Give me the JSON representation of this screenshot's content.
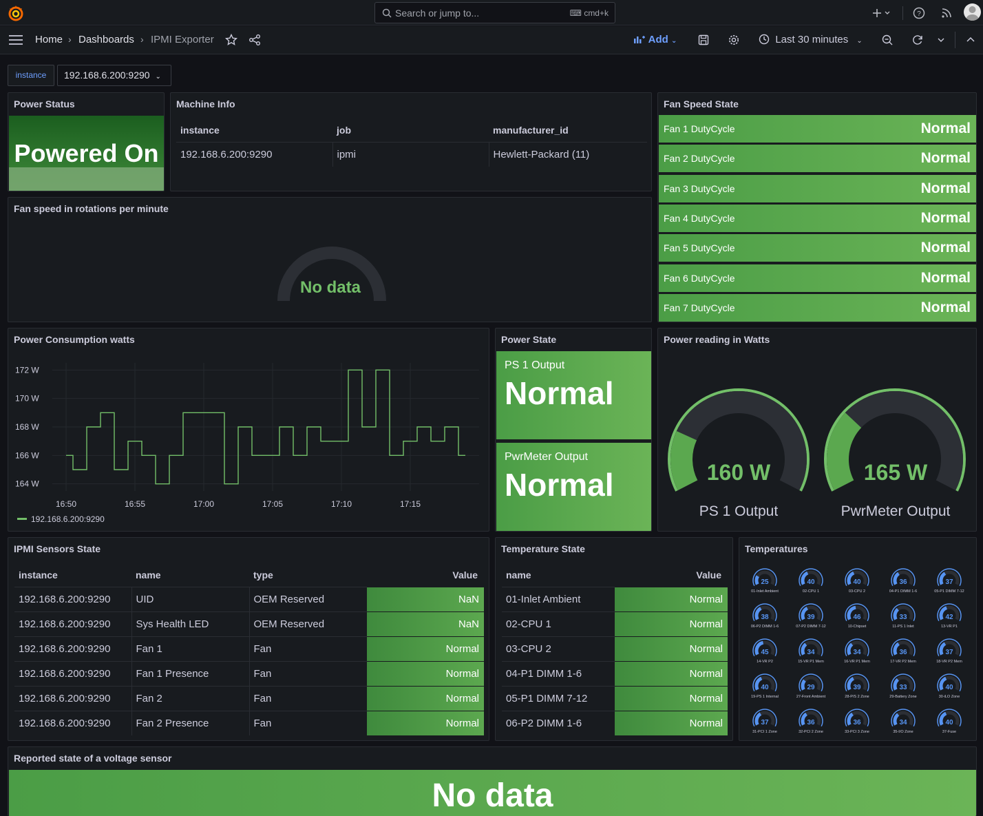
{
  "topbar": {
    "search_placeholder": "Search or jump to...",
    "search_shortcut": "cmd+k"
  },
  "nav": {
    "crumbs": [
      "Home",
      "Dashboards",
      "IPMI Exporter"
    ],
    "add_label": "Add",
    "time_range": "Last 30 minutes"
  },
  "variables": {
    "label": "instance",
    "value": "192.168.6.200:9290"
  },
  "power_status": {
    "title": "Power Status",
    "value": "Powered On"
  },
  "machine_info": {
    "title": "Machine Info",
    "columns": [
      "instance",
      "job",
      "manufacturer_id"
    ],
    "rows": [
      [
        "192.168.6.200:9290",
        "ipmi",
        "Hewlett-Packard (11)"
      ]
    ]
  },
  "fan_speed_state": {
    "title": "Fan Speed State",
    "items": [
      {
        "label": "Fan 1 DutyCycle",
        "value": "Normal"
      },
      {
        "label": "Fan 2 DutyCycle",
        "value": "Normal"
      },
      {
        "label": "Fan 3 DutyCycle",
        "value": "Normal"
      },
      {
        "label": "Fan 4 DutyCycle",
        "value": "Normal"
      },
      {
        "label": "Fan 5 DutyCycle",
        "value": "Normal"
      },
      {
        "label": "Fan 6 DutyCycle",
        "value": "Normal"
      },
      {
        "label": "Fan 7 DutyCycle",
        "value": "Normal"
      }
    ]
  },
  "fan_rpm": {
    "title": "Fan speed in rotations per minute",
    "no_data": "No data"
  },
  "power_consumption": {
    "title": "Power Consumption watts",
    "legend": "192.168.6.200:9290"
  },
  "chart_data": {
    "type": "line",
    "title": "Power Consumption watts",
    "x_ticks": [
      "16:50",
      "16:55",
      "17:00",
      "17:05",
      "17:10",
      "17:15"
    ],
    "y_ticks": [
      "164 W",
      "166 W",
      "168 W",
      "170 W",
      "172 W"
    ],
    "ylim": [
      163.5,
      172.5
    ],
    "series": [
      {
        "name": "192.168.6.200:9290",
        "color": "#73bf69",
        "x": [
          "16:50",
          "16:51",
          "16:52",
          "16:53",
          "16:54",
          "16:55",
          "16:56",
          "16:57",
          "16:58",
          "16:59",
          "17:00",
          "17:01",
          "17:02",
          "17:03",
          "17:04",
          "17:05",
          "17:06",
          "17:07",
          "17:08",
          "17:09",
          "17:10",
          "17:11",
          "17:12",
          "17:13",
          "17:14",
          "17:15",
          "17:16",
          "17:17",
          "17:18",
          "17:19"
        ],
        "values": [
          166,
          165,
          168,
          169,
          165,
          167,
          166,
          164,
          166,
          169,
          169,
          169,
          164,
          168,
          166,
          166,
          168,
          166,
          168,
          167,
          167,
          172,
          168,
          172,
          166,
          167,
          168,
          167,
          168,
          166
        ]
      }
    ],
    "legend_position": "bottom-left",
    "grid": true
  },
  "power_state": {
    "title": "Power State",
    "items": [
      {
        "label": "PS 1 Output",
        "value": "Normal"
      },
      {
        "label": "PwrMeter Output",
        "value": "Normal"
      }
    ]
  },
  "power_reading": {
    "title": "Power reading in Watts",
    "gauges": [
      {
        "label": "PS 1 Output",
        "value_text": "160 W",
        "fraction": 0.22
      },
      {
        "label": "PwrMeter Output",
        "value_text": "165 W",
        "fraction": 0.3
      }
    ]
  },
  "sensors_state": {
    "title": "IPMI Sensors State",
    "columns": [
      "instance",
      "name",
      "type",
      "Value"
    ],
    "rows": [
      [
        "192.168.6.200:9290",
        "UID",
        "OEM Reserved",
        "NaN"
      ],
      [
        "192.168.6.200:9290",
        "Sys Health LED",
        "OEM Reserved",
        "NaN"
      ],
      [
        "192.168.6.200:9290",
        "Fan 1",
        "Fan",
        "Normal"
      ],
      [
        "192.168.6.200:9290",
        "Fan 1 Presence",
        "Fan",
        "Normal"
      ],
      [
        "192.168.6.200:9290",
        "Fan 2",
        "Fan",
        "Normal"
      ],
      [
        "192.168.6.200:9290",
        "Fan 2 Presence",
        "Fan",
        "Normal"
      ]
    ]
  },
  "temperature_state": {
    "title": "Temperature State",
    "columns": [
      "name",
      "Value"
    ],
    "rows": [
      [
        "01-Inlet Ambient",
        "Normal"
      ],
      [
        "02-CPU 1",
        "Normal"
      ],
      [
        "03-CPU 2",
        "Normal"
      ],
      [
        "04-P1 DIMM 1-6",
        "Normal"
      ],
      [
        "05-P1 DIMM 7-12",
        "Normal"
      ],
      [
        "06-P2 DIMM 1-6",
        "Normal"
      ]
    ]
  },
  "temperatures": {
    "title": "Temperatures",
    "gauges": [
      {
        "value": "25",
        "label": "01-Inlet Ambient"
      },
      {
        "value": "40",
        "label": "02-CPU 1"
      },
      {
        "value": "40",
        "label": "03-CPU 2"
      },
      {
        "value": "36",
        "label": "04-P1 DIMM 1-6"
      },
      {
        "value": "37",
        "label": "05-P1 DIMM 7-12"
      },
      {
        "value": "38",
        "label": "06-P2 DIMM 1-6"
      },
      {
        "value": "39",
        "label": "07-P2 DIMM 7-12"
      },
      {
        "value": "46",
        "label": "10-Chipset"
      },
      {
        "value": "33",
        "label": "11-PS 1 Inlet"
      },
      {
        "value": "42",
        "label": "13-VR P1"
      },
      {
        "value": "45",
        "label": "14-VR P2"
      },
      {
        "value": "34",
        "label": "15-VR P1 Mem"
      },
      {
        "value": "34",
        "label": "16-VR P1 Mem"
      },
      {
        "value": "36",
        "label": "17-VR P2 Mem"
      },
      {
        "value": "37",
        "label": "18-VR P2 Mem"
      },
      {
        "value": "40",
        "label": "19-PS 1 Internal"
      },
      {
        "value": "29",
        "label": "27-Front Ambient"
      },
      {
        "value": "39",
        "label": "28-P/S 2 Zone"
      },
      {
        "value": "33",
        "label": "29-Battery Zone"
      },
      {
        "value": "40",
        "label": "30-iLO Zone"
      },
      {
        "value": "37",
        "label": "31-PCI 1 Zone"
      },
      {
        "value": "36",
        "label": "32-PCI 2 Zone"
      },
      {
        "value": "36",
        "label": "33-PCI 3 Zone"
      },
      {
        "value": "34",
        "label": "35-I/O Zone"
      },
      {
        "value": "40",
        "label": "37-Fuse"
      }
    ]
  },
  "voltage": {
    "title": "Reported state of a voltage sensor",
    "no_data": "No data"
  },
  "colors": {
    "accent": "#6e9fff",
    "ok_green": "#5aa64f",
    "panel_bg": "#181b1f",
    "page_bg": "#111217"
  }
}
